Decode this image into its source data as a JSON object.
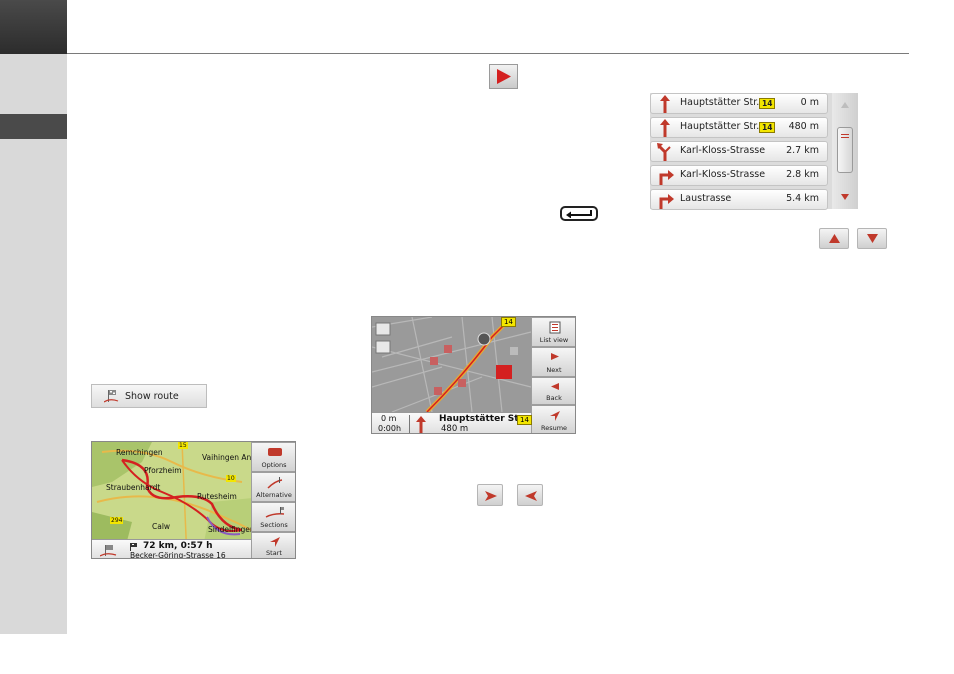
{
  "page": {
    "colors": {
      "sidebar": "#d9d9d9",
      "sidebar_dark": "#3a3a3a",
      "route_red": "#d42020",
      "badge_yellow": "#f3e600"
    }
  },
  "icons": {
    "play": "play-arrow-icon",
    "back": "back-return-icon",
    "scroll_up": "arrow-up-icon",
    "scroll_down": "arrow-down-icon",
    "next": "arrow-right-icon",
    "previous": "arrow-left-icon"
  },
  "turn_list": {
    "rows": [
      {
        "street": "Hauptstätter Str...",
        "badge": "14",
        "distance": "0 m",
        "icon": "straight-arrow-icon"
      },
      {
        "street": "Hauptstätter Str...",
        "badge": "14",
        "distance": "480 m",
        "icon": "straight-arrow-icon"
      },
      {
        "street": "Karl-Kloss-Strasse",
        "badge": "",
        "distance": "2.7 km",
        "icon": "fork-left-icon"
      },
      {
        "street": "Karl-Kloss-Strasse",
        "badge": "",
        "distance": "2.8 km",
        "icon": "turn-right-icon"
      },
      {
        "street": "Laustrasse",
        "badge": "",
        "distance": "5.4 km",
        "icon": "turn-right-icon"
      }
    ]
  },
  "show_route": {
    "label": "Show route"
  },
  "route_overview": {
    "places": [
      "Remchingen",
      "Vaihingen An D...",
      "Pforzheim",
      "Straubenhardt",
      "Rutesheim",
      "Calw",
      "Sindelfingen"
    ],
    "road_numbers": [
      "15",
      "10",
      "294"
    ],
    "buttons": {
      "options": "Options",
      "alternative": "Alternative",
      "sections": "Sections",
      "start": "Start"
    },
    "summary": "72 km, 0:57 h",
    "destination": "Becker-Göring-Strasse 16"
  },
  "route_list": {
    "buttons": {
      "list_view": "List view",
      "next": "Next",
      "back": "Back",
      "resume": "Resume"
    },
    "distance": "0 m",
    "time": "0:00h",
    "street": "Hauptstätter Str...",
    "street_distance": "480 m",
    "badge": "14"
  }
}
